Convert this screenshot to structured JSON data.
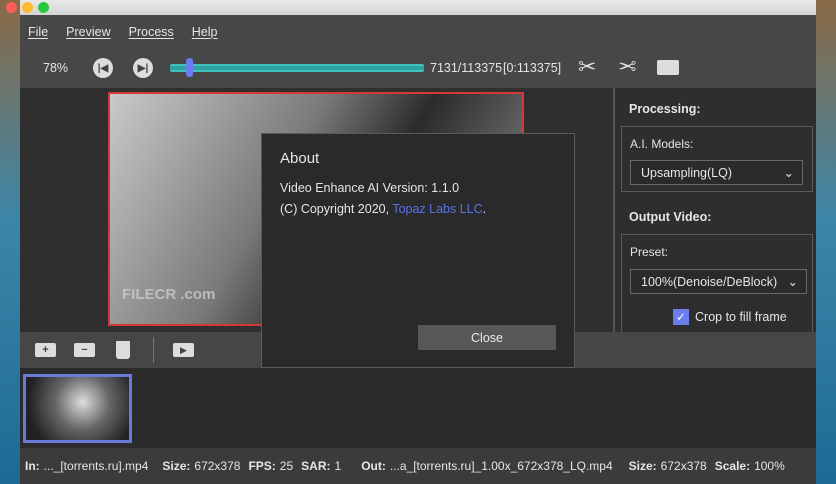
{
  "menu": [
    "File",
    "Preview",
    "Process",
    "Help"
  ],
  "toolbar": {
    "zoom": "78%",
    "frame_counter": "7131/113375",
    "range": "[0:113375]",
    "progress_fraction": 0.063
  },
  "panel": {
    "processing_title": "Processing:",
    "ai_models_label": "A.I. Models:",
    "ai_model_value": "Upsampling(LQ)",
    "output_title": "Output Video:",
    "preset_label": "Preset:",
    "preset_value": "100%(Denoise/DeBlock)",
    "crop_label": "Crop to fill frame",
    "crop_checked": true
  },
  "preview": {
    "watermark": "FILECR .com"
  },
  "dialog": {
    "title": "About",
    "version": "Video Enhance AI Version: 1.1.0",
    "copyright_prefix": "(C) Copyright 2020, ",
    "link": "Topaz Labs LLC",
    "suffix": ".",
    "close": "Close"
  },
  "status": {
    "in_label": "In:",
    "in_value": "..._[torrents.ru].mp4",
    "size_label": "Size:",
    "size_value": "672x378",
    "fps_label": "FPS:",
    "fps_value": "25",
    "sar_label": "SAR:",
    "sar_value": "1",
    "out_label": "Out:",
    "out_value": "...a_[torrents.ru]_1.00x_672x378_LQ.mp4",
    "out_size_label": "Size:",
    "out_size_value": "672x378",
    "scale_label": "Scale:",
    "scale_value": "100%"
  }
}
